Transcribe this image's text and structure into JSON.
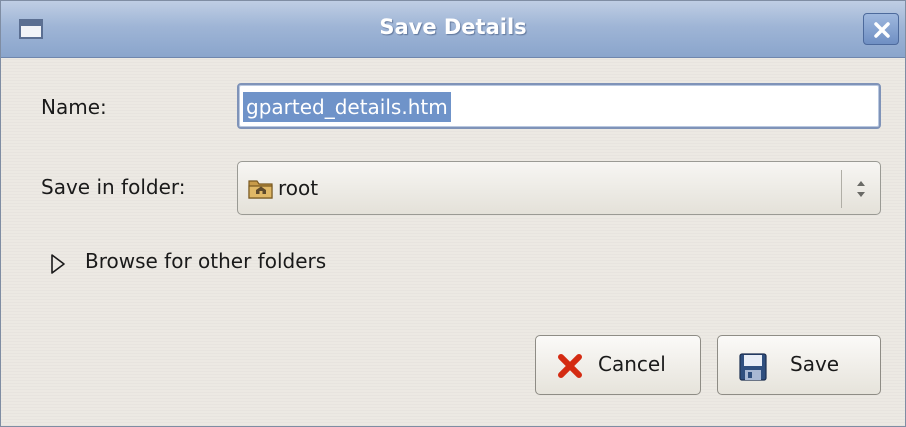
{
  "window": {
    "title": "Save Details"
  },
  "form": {
    "name_label": "Name:",
    "name_value": "gparted_details.htm",
    "folder_label": "Save in folder:",
    "folder_value": "root",
    "folder_icon": "home-folder-icon",
    "browse_label": "Browse for other folders"
  },
  "buttons": {
    "cancel_label": "Cancel",
    "cancel_icon": "red-x-icon",
    "save_label": "Save",
    "save_icon": "floppy-disk-icon"
  },
  "colors": {
    "titlebar": "#9fb5d6",
    "selection": "#6f93c9",
    "cancel_x": "#d42b12"
  }
}
